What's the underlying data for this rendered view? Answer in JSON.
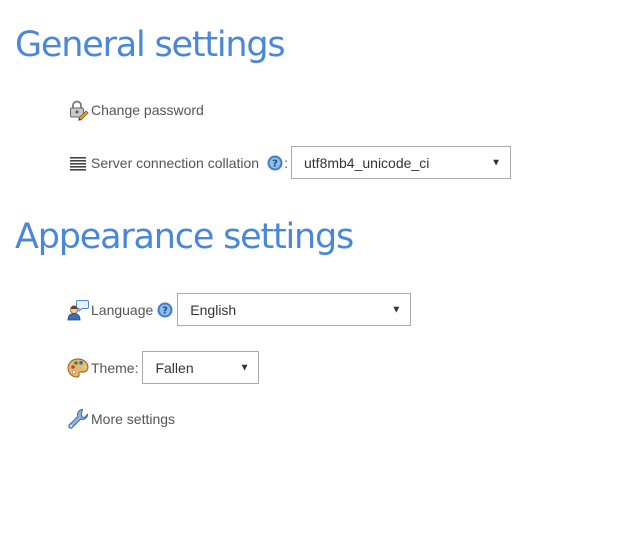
{
  "general": {
    "title": "General settings",
    "change_password": "Change password",
    "collation_label": "Server connection collation",
    "collation_colon": ":",
    "collation_value": "utf8mb4_unicode_ci"
  },
  "appearance": {
    "title": "Appearance settings",
    "language_label": "Language",
    "language_value": "English",
    "theme_label": "Theme:",
    "theme_value": "Fallen",
    "more_settings": "More settings"
  },
  "icons": {
    "change_password": "lock-pencil-icon",
    "collation": "list-icon",
    "help": "help-icon",
    "language": "user-speech-icon",
    "theme": "palette-icon",
    "more_settings": "wrench-icon"
  },
  "colors": {
    "heading": "#4a87d9",
    "text": "#555555",
    "border": "#aaaaaa"
  }
}
